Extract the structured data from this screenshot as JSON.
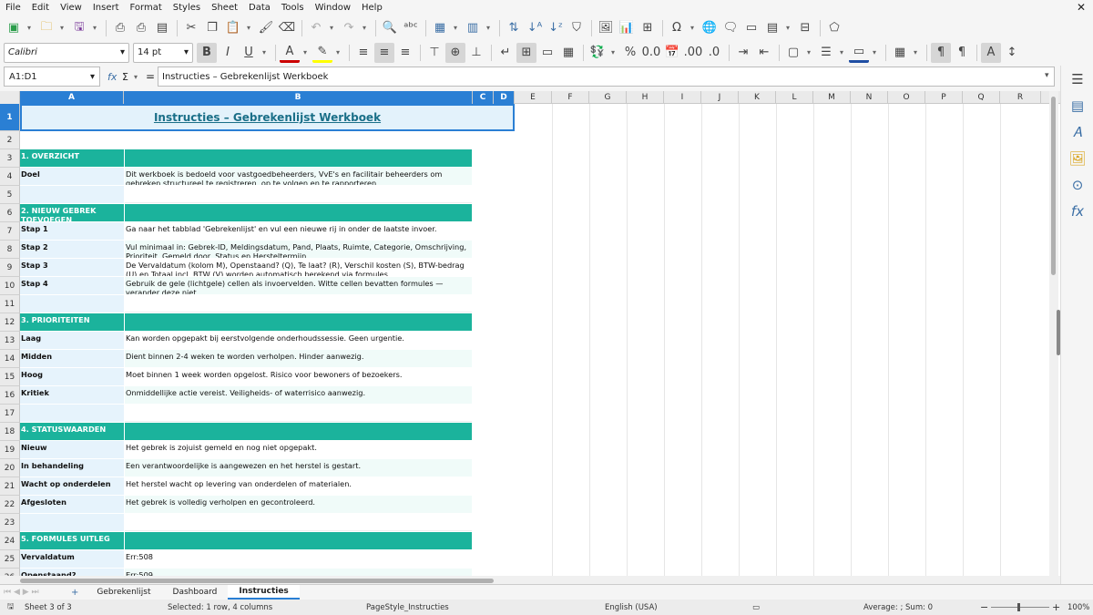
{
  "menu": [
    "File",
    "Edit",
    "View",
    "Insert",
    "Format",
    "Styles",
    "Sheet",
    "Data",
    "Tools",
    "Window",
    "Help"
  ],
  "toolbar": {
    "font_name": "Calibri",
    "font_size": "14 pt"
  },
  "namebox": "A1:D1",
  "formula_bar": {
    "fx": "fx",
    "sum": "Σ",
    "eq": "=",
    "content": "Instructies – Gebrekenlijst Werkboek"
  },
  "columns": [
    "A",
    "B",
    "C",
    "D",
    "E",
    "F",
    "G",
    "H",
    "I",
    "J",
    "K",
    "L",
    "M",
    "N",
    "O",
    "P",
    "Q",
    "R"
  ],
  "rows": [
    "1",
    "2",
    "3",
    "4",
    "5",
    "6",
    "7",
    "8",
    "9",
    "10",
    "11",
    "12",
    "13",
    "14",
    "15",
    "16",
    "17",
    "18",
    "19",
    "20",
    "21",
    "22",
    "23",
    "24",
    "25",
    "26"
  ],
  "title": "Instructies – Gebrekenlijst Werkboek",
  "sections": {
    "s1": "1. OVERZICHT",
    "s2": "2. NIEUW GEBREK TOEVOEGEN",
    "s3": "3. PRIORITEITEN",
    "s4": "4. STATUSWAARDEN",
    "s5": "5. FORMULES UITLEG"
  },
  "content": {
    "doel_label": "Doel",
    "doel_text": "Dit werkboek is bedoeld voor vastgoedbeheerders, VvE's en facilitair beheerders om gebreken structureel te registreren, op te volgen en te rapporteren.",
    "stap1_label": "Stap 1",
    "stap1_text": "Ga naar het tabblad 'Gebrekenlijst' en vul een nieuwe rij in onder de laatste invoer.",
    "stap2_label": "Stap 2",
    "stap2_text": "Vul minimaal in: Gebrek-ID, Meldingsdatum, Pand, Plaats, Ruimte, Categorie, Omschrijving, Prioriteit, Gemeld door, Status en Hersteltermijn.",
    "stap3_label": "Stap 3",
    "stap3_text": "De Vervaldatum (kolom M), Openstaand? (Q), Te laat? (R), Verschil kosten (S), BTW-bedrag (U) en Totaal incl. BTW (V) worden automatisch berekend via formules.",
    "stap4_label": "Stap 4",
    "stap4_text": "Gebruik de gele (lichtgele) cellen als invoervelden. Witte cellen bevatten formules — verander deze niet.",
    "laag_label": "Laag",
    "laag_text": "Kan worden opgepakt bij eerstvolgende onderhoudssessie. Geen urgentie.",
    "midden_label": "Midden",
    "midden_text": "Dient binnen 2-4 weken te worden verholpen. Hinder aanwezig.",
    "hoog_label": "Hoog",
    "hoog_text": "Moet binnen 1 week worden opgelost. Risico voor bewoners of bezoekers.",
    "kritiek_label": "Kritiek",
    "kritiek_text": "Onmiddellijke actie vereist. Veiligheids- of waterrisico aanwezig.",
    "nieuw_label": "Nieuw",
    "nieuw_text": "Het gebrek is zojuist gemeld en nog niet opgepakt.",
    "behandeling_label": "In behandeling",
    "behandeling_text": "Een verantwoordelijke is aangewezen en het herstel is gestart.",
    "wacht_label": "Wacht op onderdelen",
    "wacht_text": "Het herstel wacht op levering van onderdelen of materialen.",
    "afgesloten_label": "Afgesloten",
    "afgesloten_text": "Het gebrek is volledig verholpen en gecontroleerd.",
    "vervaldatum_label": "Vervaldatum",
    "vervaldatum_text": "Err:508",
    "openstaand_label": "Openstaand?",
    "openstaand_text": "Err:509"
  },
  "tabs": [
    "Gebrekenlijst",
    "Dashboard",
    "Instructies"
  ],
  "status": {
    "sheet": "Sheet 3 of 3",
    "selection": "Selected: 1 row, 4 columns",
    "pagestyle": "PageStyle_Instructies",
    "language": "English (USA)",
    "summary": "Average: ; Sum: 0",
    "zoom": "100%"
  }
}
